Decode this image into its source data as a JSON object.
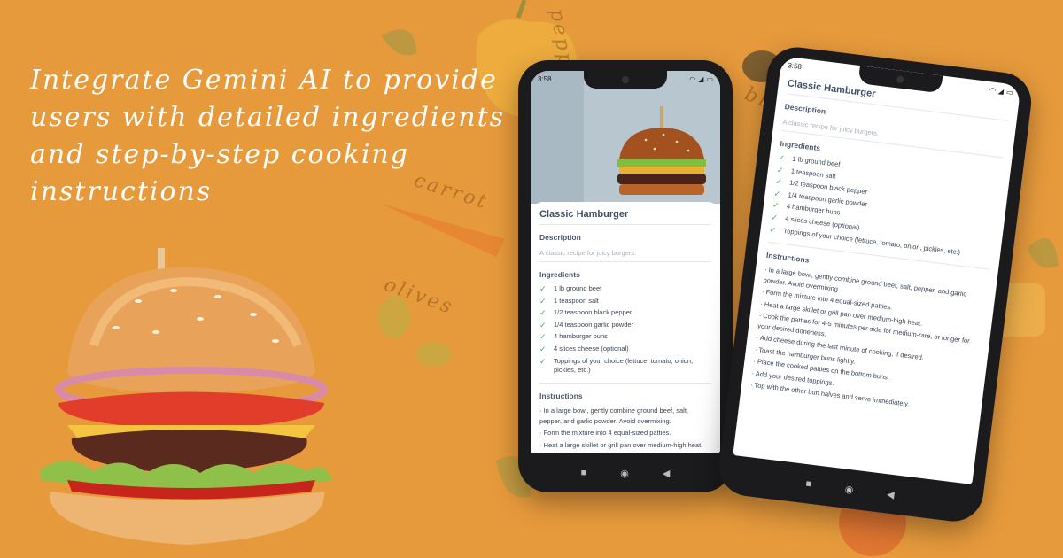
{
  "headline": "Integrate Gemini AI to provide users with detailed ingredients and step-by-step cooking instructions",
  "background_words": [
    "pepper",
    "carrot",
    "olives",
    "black p"
  ],
  "colors": {
    "background": "#E69A3C",
    "check": "#3fae60",
    "heading": "#3f4f66"
  },
  "phone_front": {
    "status": {
      "time": "3:58"
    },
    "recipe": {
      "title": "Classic Hamburger",
      "description_label": "Description",
      "description": "A classic recipe for juicy burgers.",
      "ingredients_label": "Ingredients",
      "ingredients": [
        "1 lb ground beef",
        "1 teaspoon salt",
        "1/2 teaspoon black pepper",
        "1/4 teaspoon garlic powder",
        "4 hamburger buns",
        "4 slices cheese (optional)",
        "Toppings of your choice (lettuce, tomato, onion, pickles, etc.)"
      ],
      "instructions_label": "Instructions",
      "instructions": [
        "· In a large bowl, gently combine ground beef, salt, pepper, and garlic powder. Avoid overmixing.",
        "· Form the mixture into 4 equal-sized patties.",
        "· Heat a large skillet or grill pan over medium-high heat."
      ]
    },
    "nav": {
      "recents_icon": "square-icon",
      "home_icon": "circle-icon",
      "back_icon": "triangle-back-icon"
    }
  },
  "phone_back": {
    "status": {
      "time": "3:58"
    },
    "recipe": {
      "title": "Classic Hamburger",
      "description_label": "Description",
      "description": "A classic recipe for juicy burgers.",
      "ingredients_label": "Ingredients",
      "ingredients": [
        "1 lb ground beef",
        "1 teaspoon salt",
        "1/2 teaspoon black pepper",
        "1/4 teaspoon garlic powder",
        "4 hamburger buns",
        "4 slices cheese (optional)",
        "Toppings of your choice (lettuce, tomato, onion, pickles, etc.)"
      ],
      "instructions_label": "Instructions",
      "instructions": [
        "· In a large bowl, gently combine ground beef, salt, pepper, and garlic powder. Avoid overmixing.",
        "· Form the mixture into 4 equal-sized patties.",
        "· Heat a large skillet or grill pan over medium-high heat.",
        "· Cook the patties for 4-5 minutes per side for medium-rare, or longer for your desired doneness.",
        "· Add cheese during the last minute of cooking, if desired.",
        "· Toast the hamburger buns lightly.",
        "· Place the cooked patties on the bottom buns.",
        "· Add your desired toppings.",
        "· Top with the other bun halves and serve immediately."
      ]
    }
  }
}
